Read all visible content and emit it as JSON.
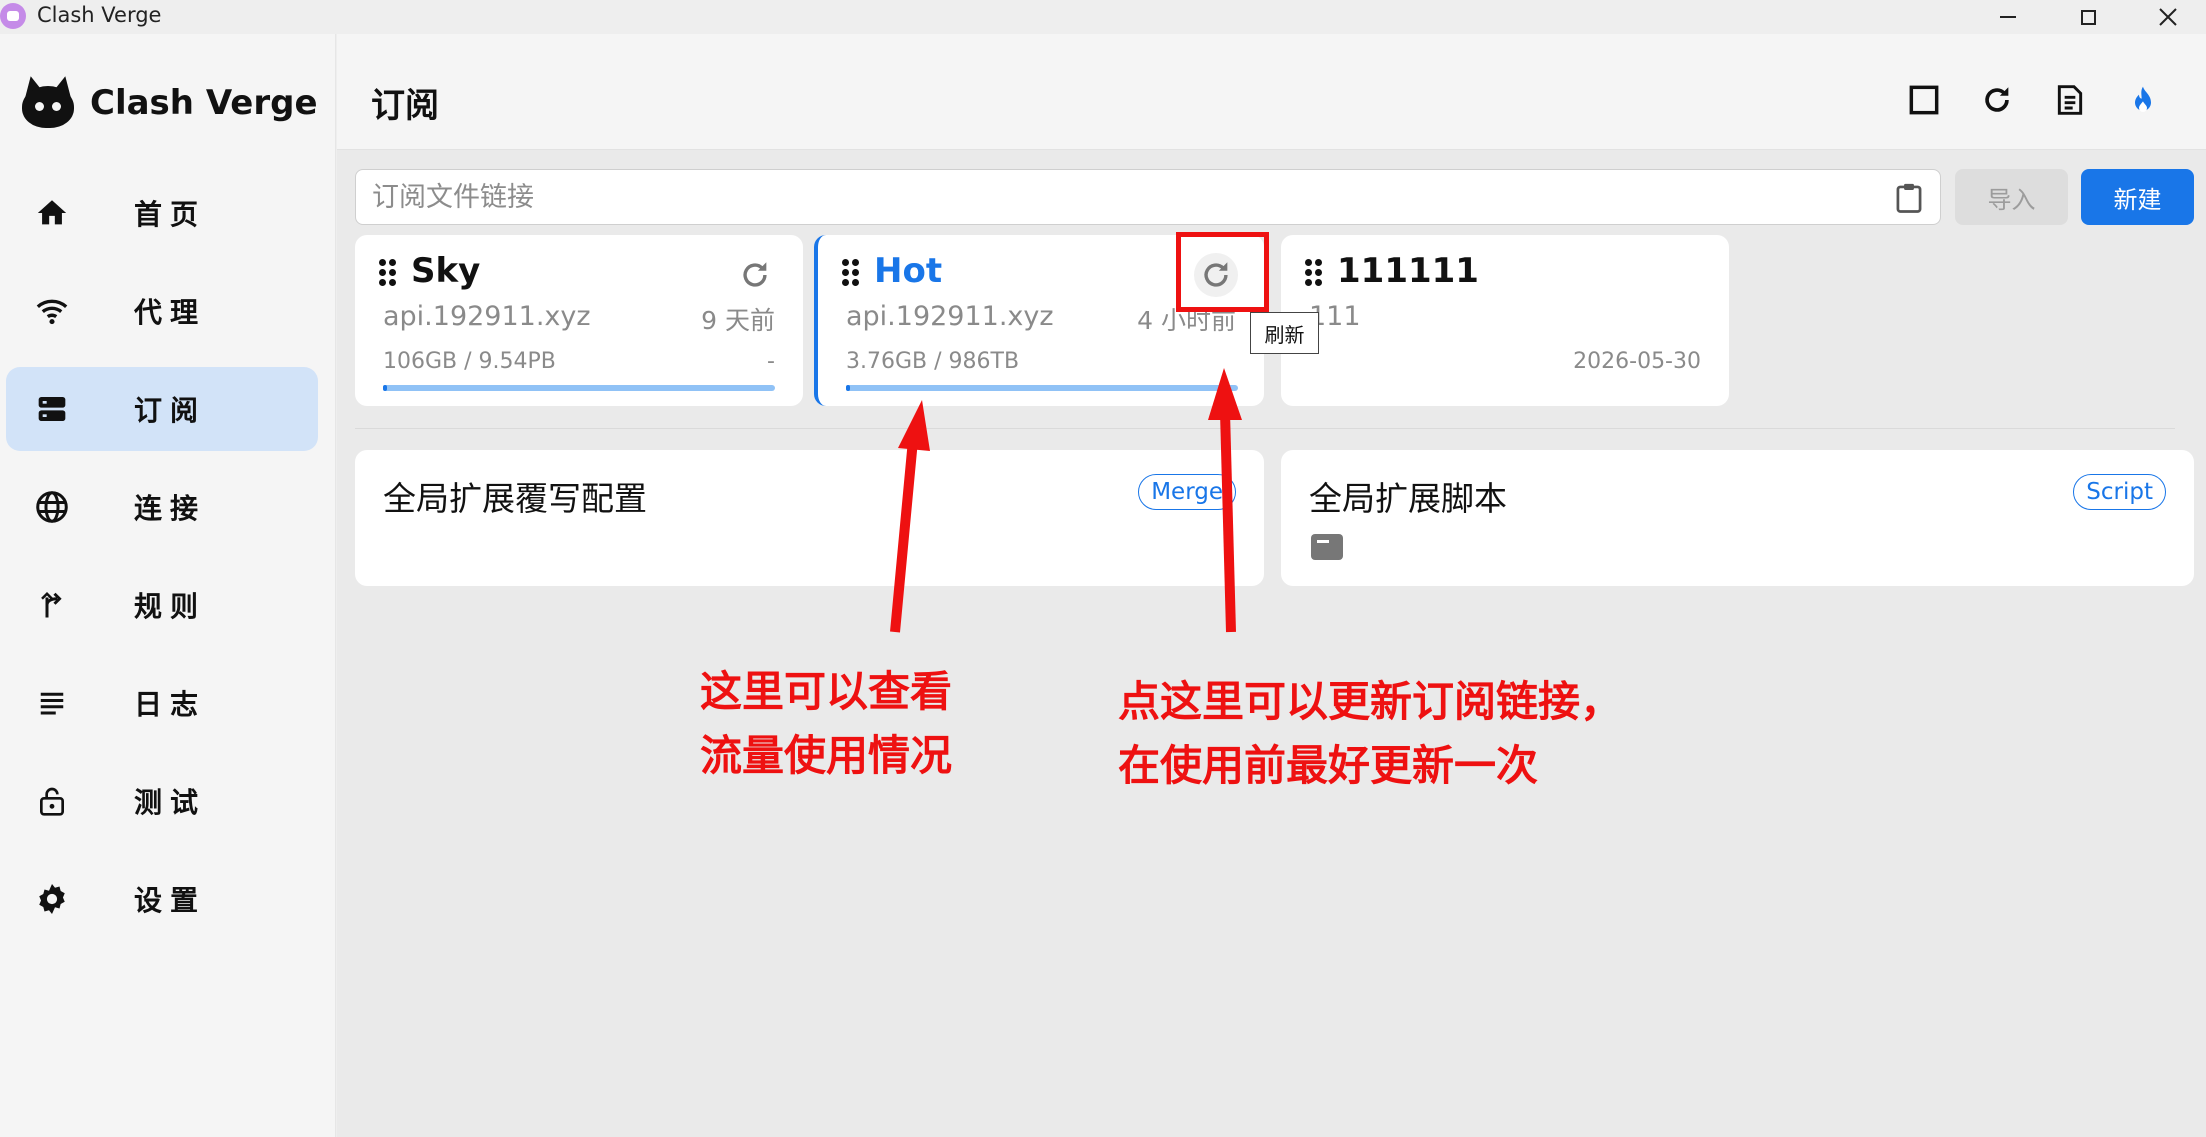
{
  "window": {
    "title": "Clash Verge"
  },
  "sidebar": {
    "brand": "Clash Verge",
    "items": [
      {
        "label": "首页",
        "icon": "home-icon"
      },
      {
        "label": "代理",
        "icon": "wifi-icon"
      },
      {
        "label": "订阅",
        "icon": "server-icon",
        "active": true
      },
      {
        "label": "连接",
        "icon": "globe-icon"
      },
      {
        "label": "规则",
        "icon": "fork-arrow-icon"
      },
      {
        "label": "日志",
        "icon": "lines-icon"
      },
      {
        "label": "测试",
        "icon": "lock-icon"
      },
      {
        "label": "设置",
        "icon": "gear-icon"
      }
    ]
  },
  "header": {
    "title": "订阅",
    "actions": [
      "square-icon",
      "refresh-icon",
      "document-icon",
      "flame-icon"
    ]
  },
  "toolbar": {
    "url_placeholder": "订阅文件链接",
    "import_label": "导入",
    "new_label": "新建"
  },
  "profiles": [
    {
      "name": "Sky",
      "host": "api.192911.xyz",
      "updated": "9 天前",
      "traffic": "106GB / 9.54PB",
      "expire": "-",
      "usage_fraction": 0.01
    },
    {
      "name": "Hot",
      "host": "api.192911.xyz",
      "updated": "4 小时前",
      "traffic": "3.76GB / 986TB",
      "expire": "",
      "usage_fraction": 0.01,
      "selected": true
    },
    {
      "name": "111111",
      "host": "111",
      "updated": "",
      "traffic": "",
      "expire": "2026-05-30"
    }
  ],
  "extensions": [
    {
      "title": "全局扩展覆写配置",
      "chip": "Merge"
    },
    {
      "title": "全局扩展脚本",
      "chip": "Script"
    }
  ],
  "tooltip": "刷新",
  "annotations": {
    "traffic_note_line1": "这里可以查看",
    "traffic_note_line2": "流量使用情况",
    "refresh_note_line1": "点这里可以更新订阅链接，",
    "refresh_note_line2": "在使用前最好更新一次"
  },
  "colors": {
    "accent": "#1976e8",
    "annotation": "#ee1111",
    "active_nav": "#d2e3f8"
  }
}
